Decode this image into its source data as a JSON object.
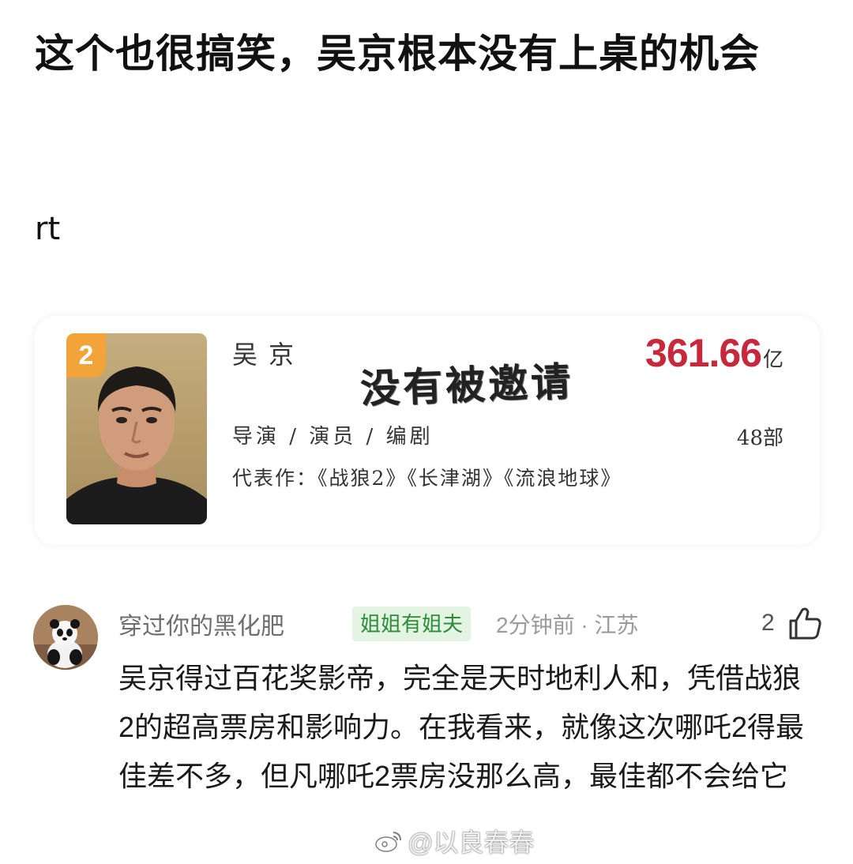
{
  "post": {
    "title": "这个也很搞笑，吴京根本没有上桌的机会",
    "body": "rt"
  },
  "card": {
    "rank": "2",
    "name": "吴京",
    "overlay_text": "没有被邀请",
    "box_office_value": "361.66",
    "box_office_unit": "亿",
    "roles": "导演 / 演员 / 编剧",
    "film_count": "48部",
    "works": "代表作：《战狼2》《长津湖》《流浪地球》",
    "box_office_color": "#c8283c",
    "badge_color": "#f2a33a"
  },
  "comment": {
    "username": "穿过你的黑化肥",
    "tag": "姐姐有姐夫",
    "meta": "2分钟前 · 江苏",
    "likes": "2",
    "text": "吴京得过百花奖影帝，完全是天时地利人和，凭借战狼2的超高票房和影响力。在我看来，就像这次哪吒2得最佳差不多，但凡哪吒2票房没那么高，最佳都不会给它",
    "avatar_icon": "panda-avatar",
    "like_icon": "thumbs-up-icon",
    "tag_color": "#2e8b3a"
  },
  "watermark": {
    "text": "@以良春春",
    "icon": "weibo-logo-icon"
  }
}
